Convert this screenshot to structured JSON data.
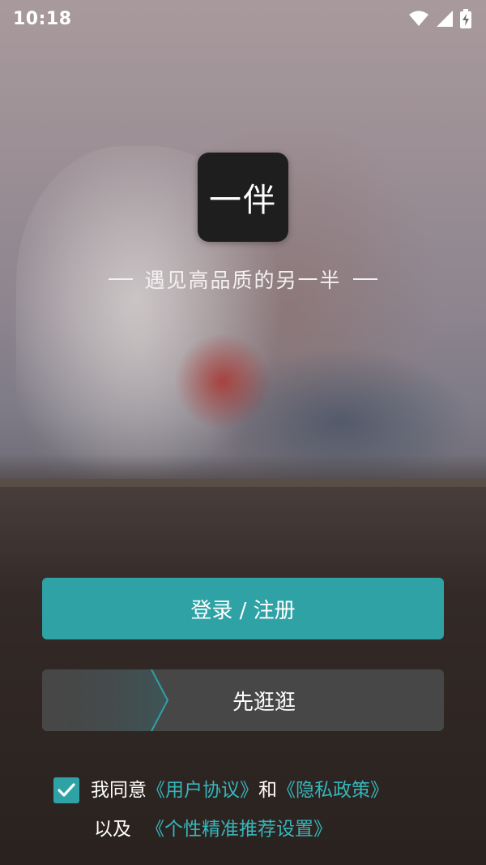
{
  "status_bar": {
    "time": "10:18",
    "icons": [
      "wifi-icon",
      "signal-icon",
      "battery-charging-icon"
    ]
  },
  "app": {
    "logo_text": "一伴",
    "tagline": "遇见高品质的另一半"
  },
  "actions": {
    "login_label": "登录 / 注册",
    "browse_label": "先逛逛"
  },
  "agreement": {
    "checked": true,
    "prefix": "我同意",
    "user_agreement": "《用户协议》",
    "and": "和",
    "privacy_policy": "《隐私政策》",
    "also": "以及",
    "recommend_settings": "《个性精准推荐设置》"
  },
  "colors": {
    "accent": "#2fa2a6",
    "link": "#35b6bb",
    "secondary_button": "#474747",
    "logo_bg": "#1e1e1e"
  }
}
